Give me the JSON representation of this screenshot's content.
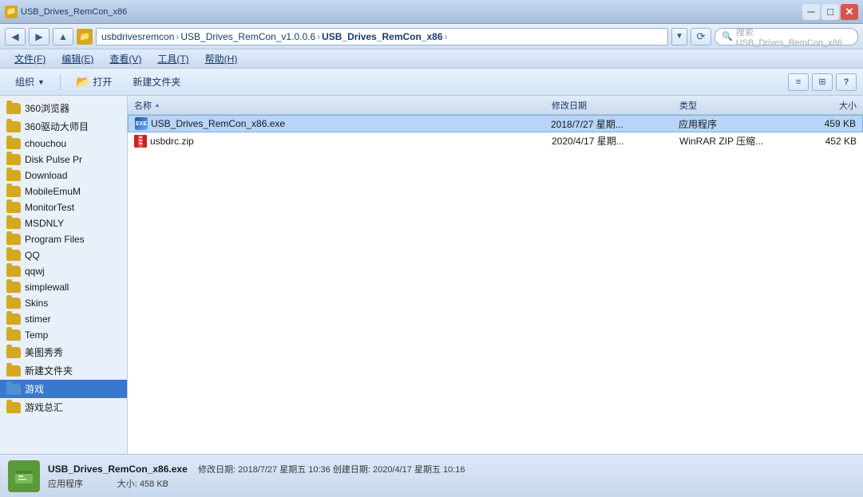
{
  "titlebar": {
    "title": "USB_Drives_RemCon_x86",
    "min_label": "─",
    "max_label": "□",
    "close_label": "✕"
  },
  "addressbar": {
    "back_label": "◀",
    "forward_label": "▶",
    "up_label": "▲",
    "path": {
      "part1": "usbdrivesremcon",
      "sep1": "›",
      "part2": "USB_Drives_RemCon_v1.0.0.6",
      "sep2": "›",
      "part3": "USB_Drives_RemCon_x86",
      "sep3": "›"
    },
    "refresh_label": "⟳",
    "search_placeholder": "搜索 USB_Drives_RemCon_x86"
  },
  "menubar": {
    "items": [
      {
        "label": "文件(F)",
        "underline": "F"
      },
      {
        "label": "编辑(E)",
        "underline": "E"
      },
      {
        "label": "查看(V)",
        "underline": "V"
      },
      {
        "label": "工具(T)",
        "underline": "T"
      },
      {
        "label": "帮助(H)",
        "underline": "H"
      }
    ]
  },
  "toolbar": {
    "organize_label": "组织",
    "dropdown_label": "▼",
    "open_label": "打开",
    "newfolder_label": "新建文件夹",
    "view_icon": "≡",
    "layout_icon": "⊞",
    "help_icon": "?"
  },
  "sidebar": {
    "items": [
      {
        "label": "360浏览器",
        "type": "folder"
      },
      {
        "label": "360驱动大师目",
        "type": "folder"
      },
      {
        "label": "chouchou",
        "type": "folder"
      },
      {
        "label": "Disk Pulse Pr",
        "type": "folder"
      },
      {
        "label": "Download",
        "type": "folder",
        "active": false
      },
      {
        "label": "MobileEmuM",
        "type": "folder"
      },
      {
        "label": "MonitorTest",
        "type": "folder"
      },
      {
        "label": "MSDNLY",
        "type": "folder"
      },
      {
        "label": "Program Files",
        "type": "folder"
      },
      {
        "label": "QQ",
        "type": "folder"
      },
      {
        "label": "qqwj",
        "type": "folder"
      },
      {
        "label": "simplewall",
        "type": "folder"
      },
      {
        "label": "Skins",
        "type": "folder"
      },
      {
        "label": "stimer",
        "type": "folder"
      },
      {
        "label": "Temp",
        "type": "folder"
      },
      {
        "label": "美图秀秀",
        "type": "folder"
      },
      {
        "label": "新建文件夹",
        "type": "folder"
      },
      {
        "label": "游戏",
        "type": "folder",
        "active": true
      },
      {
        "label": "游戏总汇",
        "type": "folder"
      }
    ]
  },
  "columns": {
    "name": "名称",
    "date": "修改日期",
    "type": "类型",
    "size": "大小",
    "sort_arrow": "▲"
  },
  "files": [
    {
      "name": "USB_Drives_RemCon_x86.exe",
      "date": "2018/7/27 星期...",
      "type": "应用程序",
      "size": "459 KB",
      "icon_type": "exe",
      "selected": true
    },
    {
      "name": "usbdrc.zip",
      "date": "2020/4/17 星期...",
      "type": "WinRAR ZIP 压缩...",
      "size": "452 KB",
      "icon_type": "zip",
      "selected": false
    }
  ],
  "statusbar": {
    "filename": "USB_Drives_RemCon_x86.exe",
    "desc": "修改日期: 2018/7/27 星期五 10:36  创建日期: 2020/4/17 星期五 10:16",
    "type_label": "应用程序",
    "size_label": "大小: 458 KB"
  }
}
